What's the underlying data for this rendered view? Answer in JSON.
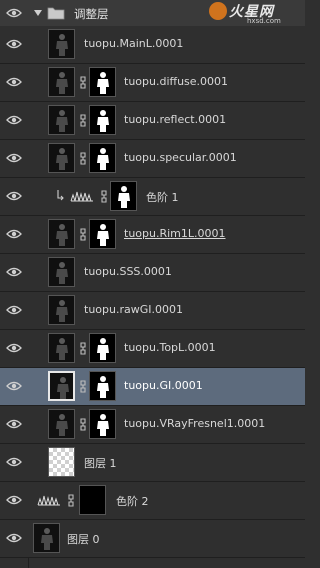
{
  "panel": {
    "group": {
      "label": "调整层",
      "expanded": true,
      "icons": [
        "eye-icon",
        "disclosure-triangle-icon",
        "folder-icon"
      ]
    },
    "watermark": {
      "name": "火星网",
      "url": "hxsd.com"
    },
    "selected_color": "#5d6b7d",
    "layers": [
      {
        "label": "tuopu.MainL.0001",
        "type": "image",
        "selected": false
      },
      {
        "label": "tuopu.diffuse.0001",
        "type": "image-with-mask",
        "selected": false
      },
      {
        "label": "tuopu.reflect.0001",
        "type": "image-with-mask",
        "selected": false
      },
      {
        "label": "tuopu.specular.0001",
        "type": "image-with-mask",
        "selected": false
      },
      {
        "label": "色阶 1",
        "type": "adjustment-levels-clipped",
        "selected": false
      },
      {
        "label": "tuopu.Rim1L.0001",
        "type": "image-with-mask",
        "selected": false,
        "underlined": true
      },
      {
        "label": "tuopu.SSS.0001",
        "type": "image",
        "selected": false
      },
      {
        "label": "tuopu.rawGI.0001",
        "type": "image",
        "selected": false
      },
      {
        "label": "tuopu.TopL.0001",
        "type": "image-with-mask",
        "selected": false
      },
      {
        "label": "tuopu.GI.0001",
        "type": "image-with-mask",
        "selected": true
      },
      {
        "label": "tuopu.VRayFresnel1.0001",
        "type": "image-with-mask",
        "selected": false
      },
      {
        "label": "图层 1",
        "type": "transparent",
        "selected": false
      },
      {
        "label": "色阶 2",
        "type": "adjustment-levels",
        "selected": false
      },
      {
        "label": "图层 0",
        "type": "image",
        "selected": false
      }
    ]
  }
}
